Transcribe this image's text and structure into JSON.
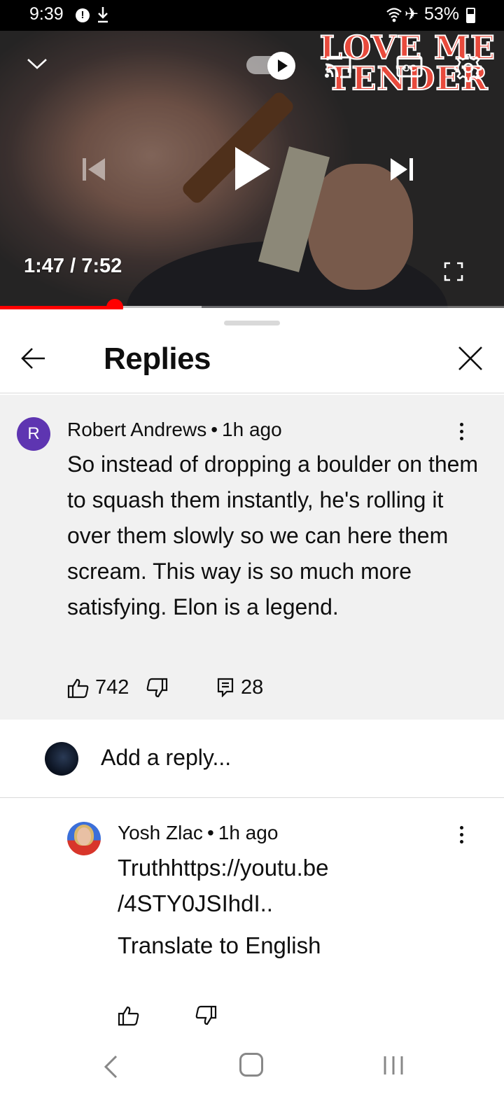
{
  "status_bar": {
    "time": "9:39",
    "alert_icon": "!",
    "battery": "53%"
  },
  "video": {
    "time_text": "1:47 / 7:52",
    "overlay_line1": "LOVE ME",
    "overlay_line2": "TENDER",
    "progress_played": 0.2271,
    "progress_buffered": 0.4
  },
  "sheet": {
    "title": "Replies"
  },
  "comment": {
    "avatar_letter": "R",
    "author": "Robert Andrews",
    "time": "1h ago",
    "text": "So instead of dropping a boulder on them to squash them instantly, he's rolling it over them slowly so we can here them scream. This way is so much more satisfying. Elon is a legend.",
    "likes": "742",
    "replies": "28"
  },
  "add_reply": {
    "placeholder": "Add a reply..."
  },
  "reply": {
    "author": "Yosh Zlac",
    "time": "1h ago",
    "text_line1": "Truthhttps://youtu.be",
    "text_line2": "/4STY0JSIhdI..",
    "translate_label": "Translate to English"
  },
  "colors": {
    "accent_red": "#ff0000",
    "avatar_purple": "#5e35b1",
    "comment_bg": "#f1f1f1"
  },
  "icons": [
    "chevron-down-icon",
    "autoplay-toggle",
    "cast-icon",
    "cc-icon",
    "gear-icon",
    "skip-previous-icon",
    "play-icon",
    "skip-next-icon",
    "fullscreen-icon",
    "arrow-back-icon",
    "close-icon",
    "thumb-up-icon",
    "thumb-down-icon",
    "comment-icon",
    "more-vert-icon"
  ]
}
